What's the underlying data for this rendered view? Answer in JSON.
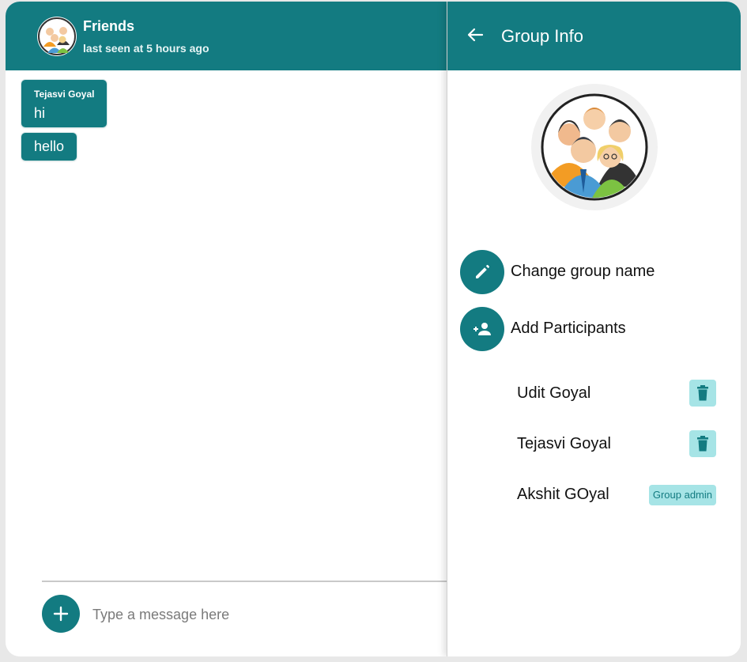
{
  "chat": {
    "title": "Friends",
    "subtitle": "last seen at 5 hours ago",
    "messages": [
      {
        "sender": "Tejasvi Goyal",
        "text": "hi"
      },
      {
        "sender": "",
        "text": "hello"
      }
    ],
    "composer": {
      "placeholder": "Type a message here",
      "add_icon": "plus-icon"
    }
  },
  "group_info": {
    "title": "Group Info",
    "actions": [
      {
        "label": "Change group name",
        "icon": "pencil-icon"
      },
      {
        "label": "Add Participants",
        "icon": "add-person-icon"
      }
    ],
    "members": [
      {
        "name": "Udit Goyal",
        "role": ""
      },
      {
        "name": "Tejasvi Goyal",
        "role": ""
      },
      {
        "name": "Akshit GOyal",
        "role": "Group admin"
      }
    ]
  },
  "colors": {
    "primary": "#137b81",
    "chip": "#a6e4e6"
  }
}
